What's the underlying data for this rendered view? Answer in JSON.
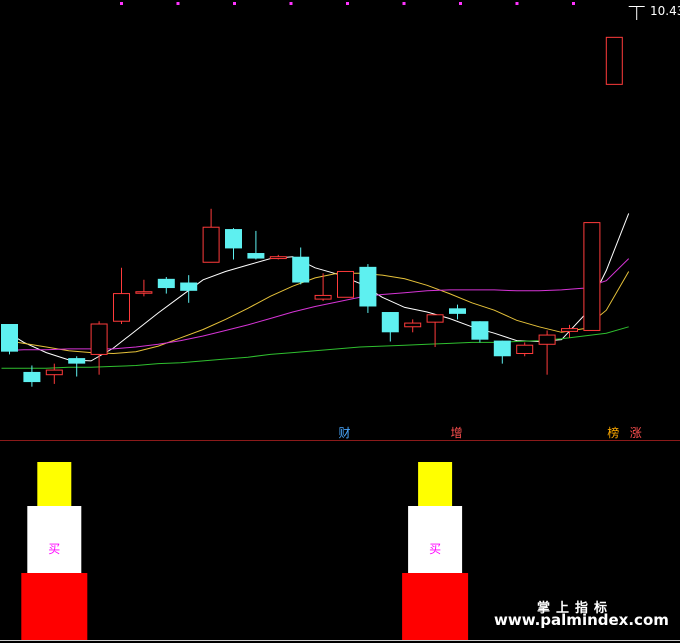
{
  "chart_data": {
    "type": "candlestick",
    "price_label": "10.43",
    "ylim": [
      6.0,
      10.6
    ],
    "candles": [
      {
        "open": 7.15,
        "close": 6.85,
        "high": 7.15,
        "low": 6.82,
        "up": false
      },
      {
        "open": 6.63,
        "close": 6.52,
        "high": 6.7,
        "low": 6.47,
        "up": false
      },
      {
        "open": 6.6,
        "close": 6.65,
        "high": 6.72,
        "low": 6.5,
        "up": true
      },
      {
        "open": 6.78,
        "close": 6.72,
        "high": 6.8,
        "low": 6.58,
        "up": false
      },
      {
        "open": 6.82,
        "close": 7.15,
        "high": 7.18,
        "low": 6.6,
        "up": true
      },
      {
        "open": 7.18,
        "close": 7.48,
        "high": 7.76,
        "low": 7.15,
        "up": true
      },
      {
        "open": 7.5,
        "close": 7.5,
        "high": 7.63,
        "low": 7.45,
        "up": true
      },
      {
        "open": 7.64,
        "close": 7.54,
        "high": 7.66,
        "low": 7.48,
        "up": false
      },
      {
        "open": 7.6,
        "close": 7.51,
        "high": 7.68,
        "low": 7.38,
        "up": false
      },
      {
        "open": 7.82,
        "close": 8.2,
        "high": 8.4,
        "low": 7.82,
        "up": true
      },
      {
        "open": 8.18,
        "close": 7.97,
        "high": 8.19,
        "low": 7.85,
        "up": false
      },
      {
        "open": 7.92,
        "close": 7.86,
        "high": 8.16,
        "low": 7.85,
        "up": false
      },
      {
        "open": 7.86,
        "close": 7.88,
        "high": 7.9,
        "low": 7.85,
        "up": true
      },
      {
        "open": 7.88,
        "close": 7.6,
        "high": 7.98,
        "low": 7.58,
        "up": false
      },
      {
        "open": 7.42,
        "close": 7.46,
        "high": 7.7,
        "low": 7.4,
        "up": true
      },
      {
        "open": 7.44,
        "close": 7.72,
        "high": 7.72,
        "low": 7.44,
        "up": true
      },
      {
        "open": 7.77,
        "close": 7.34,
        "high": 7.8,
        "low": 7.27,
        "up": false
      },
      {
        "open": 7.28,
        "close": 7.06,
        "high": 7.28,
        "low": 6.96,
        "up": false
      },
      {
        "open": 7.12,
        "close": 7.16,
        "high": 7.2,
        "low": 7.06,
        "up": true
      },
      {
        "open": 7.25,
        "close": 7.17,
        "high": 7.25,
        "low": 6.9,
        "up": true
      },
      {
        "open": 7.32,
        "close": 7.26,
        "high": 7.36,
        "low": 7.2,
        "up": false
      },
      {
        "open": 7.18,
        "close": 6.98,
        "high": 7.18,
        "low": 6.95,
        "up": false
      },
      {
        "open": 6.97,
        "close": 6.8,
        "high": 6.97,
        "low": 6.72,
        "up": false
      },
      {
        "open": 6.83,
        "close": 6.92,
        "high": 6.95,
        "low": 6.8,
        "up": true
      },
      {
        "open": 6.93,
        "close": 7.03,
        "high": 7.08,
        "low": 6.6,
        "up": true
      },
      {
        "open": 7.07,
        "close": 7.1,
        "high": 7.14,
        "low": 7.0,
        "up": true
      },
      {
        "open": 7.08,
        "close": 8.25,
        "high": 8.25,
        "low": 7.08,
        "up": true
      },
      {
        "open": 9.75,
        "close": 10.26,
        "high": 10.26,
        "low": 9.75,
        "up": true
      }
    ],
    "ma_lines": [
      {
        "name": "MA5",
        "color": "#ffffff",
        "values": [
          7.1,
          6.95,
          6.84,
          6.76,
          6.75,
          6.89,
          7.08,
          7.27,
          7.45,
          7.63,
          7.72,
          7.79,
          7.86,
          7.88,
          7.76,
          7.69,
          7.59,
          7.44,
          7.33,
          7.28,
          7.21,
          7.12,
          7.05,
          6.97,
          6.96,
          6.98,
          7.24,
          7.73,
          8.35
        ]
      },
      {
        "name": "MA10",
        "color": "#e6c23a",
        "values": [
          6.98,
          6.94,
          6.9,
          6.86,
          6.84,
          6.83,
          6.85,
          6.91,
          7.0,
          7.09,
          7.2,
          7.32,
          7.45,
          7.56,
          7.65,
          7.7,
          7.7,
          7.68,
          7.64,
          7.57,
          7.48,
          7.38,
          7.3,
          7.19,
          7.12,
          7.06,
          7.1,
          7.3,
          7.72
        ]
      },
      {
        "name": "MA20",
        "color": "#d634d6",
        "values": [
          6.86,
          6.87,
          6.87,
          6.88,
          6.88,
          6.88,
          6.9,
          6.93,
          6.97,
          7.02,
          7.08,
          7.14,
          7.21,
          7.28,
          7.34,
          7.39,
          7.44,
          7.47,
          7.49,
          7.51,
          7.52,
          7.52,
          7.52,
          7.51,
          7.51,
          7.52,
          7.54,
          7.62,
          7.86
        ]
      },
      {
        "name": "MA60",
        "color": "#2fbf2f",
        "values": [
          6.67,
          6.67,
          6.67,
          6.68,
          6.68,
          6.69,
          6.7,
          6.72,
          6.73,
          6.75,
          6.77,
          6.79,
          6.82,
          6.84,
          6.86,
          6.88,
          6.9,
          6.91,
          6.92,
          6.93,
          6.94,
          6.95,
          6.95,
          6.96,
          6.97,
          6.99,
          7.02,
          7.05,
          7.12
        ]
      }
    ],
    "markers": [
      {
        "index": 15,
        "text": "财",
        "color": "#4aa8ff"
      },
      {
        "index": 20,
        "text": "增",
        "color": "#ff5050"
      },
      {
        "index": 27,
        "text": "榜",
        "color": "#ffaa00"
      },
      {
        "index": 28,
        "text": "涨",
        "color": "#ff5050"
      }
    ],
    "signals": [
      {
        "index": 2,
        "label": "买"
      },
      {
        "index": 19,
        "label": "买"
      }
    ],
    "top_dots_count": 9
  },
  "watermark": {
    "line1": "掌上指标",
    "line2": "www.palmindex.com"
  }
}
